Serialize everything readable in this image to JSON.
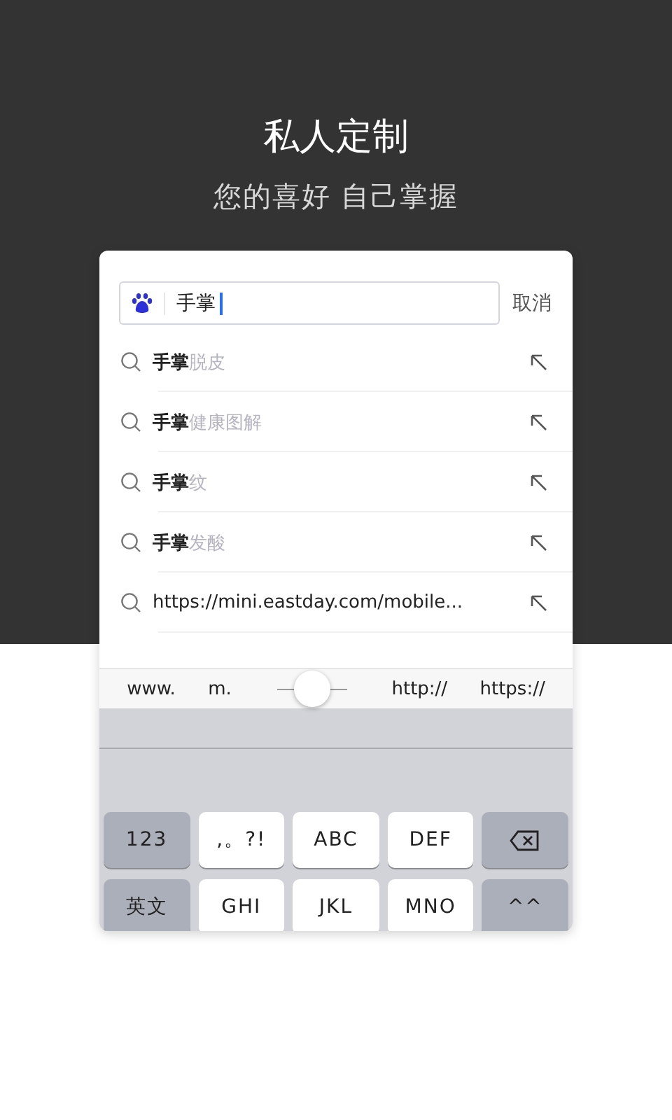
{
  "header": {
    "title": "私人定制",
    "subtitle": "您的喜好 自己掌握"
  },
  "search": {
    "value": "手掌",
    "cancel": "取消"
  },
  "suggestions": [
    {
      "kind": "suggestion",
      "query": "手掌",
      "suffix": "脱皮"
    },
    {
      "kind": "suggestion",
      "query": "手掌",
      "suffix": "健康图解"
    },
    {
      "kind": "suggestion",
      "query": "手掌",
      "suffix": "纹"
    },
    {
      "kind": "suggestion",
      "query": "手掌",
      "suffix": "发酸"
    },
    {
      "kind": "url",
      "text": "https://mini.eastday.com/mobile..."
    }
  ],
  "shortcuts": {
    "left": [
      "www.",
      "m."
    ],
    "cursor": {
      "level": 0.5
    },
    "right": [
      "http://",
      "https://"
    ]
  },
  "keyboard": [
    [
      {
        "kind": "function",
        "label": "123"
      },
      {
        "kind": "letter",
        "label": ",。?!"
      },
      {
        "kind": "letter",
        "label": "ABC"
      },
      {
        "kind": "letter",
        "label": "DEF"
      },
      {
        "kind": "backspace"
      }
    ],
    [
      {
        "kind": "function",
        "label": "英文"
      },
      {
        "kind": "letter",
        "label": "GHI"
      },
      {
        "kind": "letter",
        "label": "JKL"
      },
      {
        "kind": "letter",
        "label": "MNO"
      },
      {
        "kind": "function",
        "label": "^^"
      }
    ]
  ]
}
